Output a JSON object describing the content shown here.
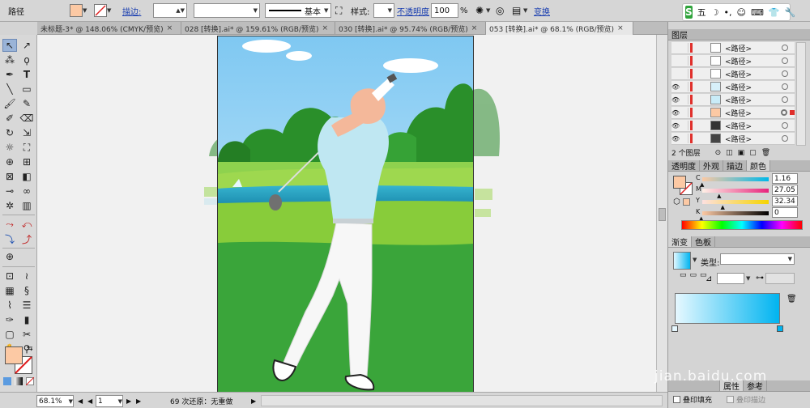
{
  "control_bar": {
    "selection_label": "路径",
    "stroke_label": "描边:",
    "line_style_label": "基本",
    "style_label": "样式:",
    "opacity_label": "不透明度",
    "opacity_value": "100",
    "percent": "%",
    "transform_label": "变换"
  },
  "tray": {
    "logo": "S",
    "ime_label": "五"
  },
  "tabs": [
    {
      "label": "未标题-3* @ 148.06% (CMYK/预览)"
    },
    {
      "label": "028 [转换].ai* @ 159.61% (RGB/预览)"
    },
    {
      "label": "030 [转换].ai* @ 95.74% (RGB/预览)"
    },
    {
      "label": "053 [转换].ai* @ 68.1% (RGB/预览)"
    }
  ],
  "layers_panel": {
    "title": "图层",
    "rows": [
      {
        "name": "<路径>"
      },
      {
        "name": "<路径>"
      },
      {
        "name": "<路径>"
      },
      {
        "name": "<路径>"
      },
      {
        "name": "<路径>"
      },
      {
        "name": "<路径>"
      },
      {
        "name": "<路径>"
      },
      {
        "name": "<路径>"
      }
    ],
    "footer": "2 个图层"
  },
  "color_panel": {
    "tabs": [
      "透明度",
      "外观",
      "描边",
      "颜色"
    ],
    "channels": [
      {
        "label": "C",
        "value": "1.16",
        "level": 0.0116
      },
      {
        "label": "M",
        "value": "27.05",
        "level": 0.2705
      },
      {
        "label": "Y",
        "value": "32.34",
        "level": 0.3234
      },
      {
        "label": "K",
        "value": "0",
        "level": 0
      }
    ]
  },
  "gradient_panel": {
    "tabs": [
      "渐变",
      "色板"
    ],
    "type_label": "类型:",
    "fill_color": "#00b4f0"
  },
  "attributes_panel": {
    "tab": "属性",
    "other_tab": "参考",
    "overprint_fill": "叠印填充",
    "overprint_stroke": "叠印描边"
  },
  "status_bar": {
    "zoom": "68.1%",
    "page": "1",
    "undo_text": "69 次还原：无重做"
  },
  "watermark": "jian.baidu.com",
  "colors": {
    "fill_swatch": "#fcc9a4",
    "sky_top": "#8ed0f5",
    "grass": "#3aa53a",
    "water": "#2bb0c8",
    "shirt": "#bfe7f2"
  }
}
